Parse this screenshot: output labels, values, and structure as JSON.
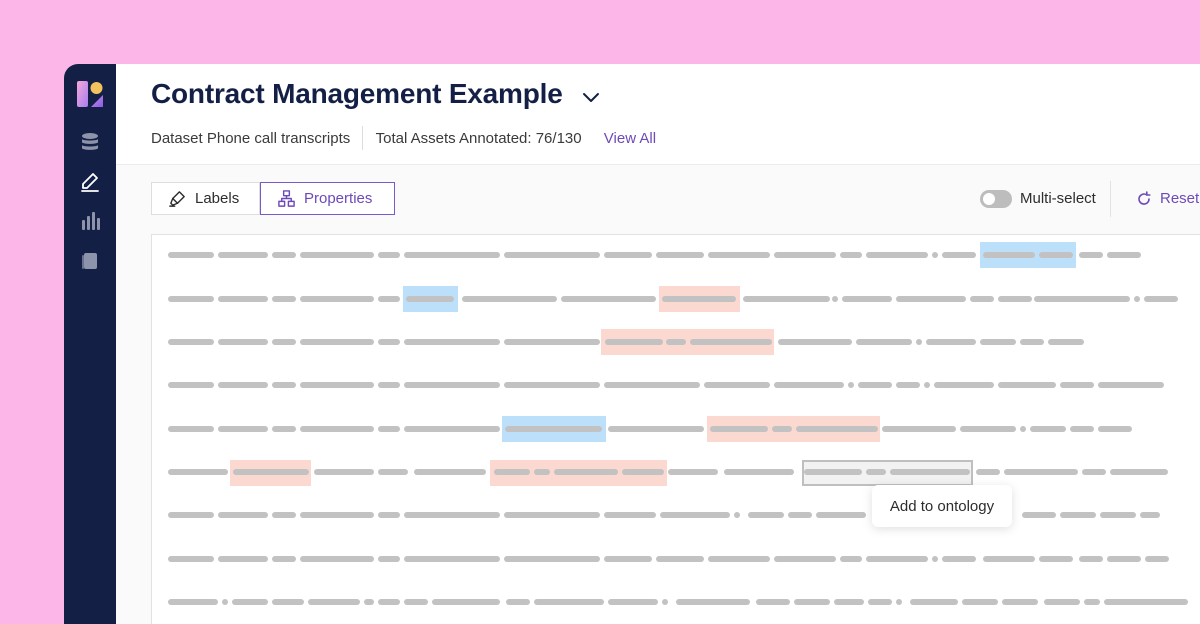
{
  "header": {
    "title": "Contract Management Example",
    "dataset": "Dataset Phone call transcripts",
    "assets_annotated": "Total Assets Annotated: 76/130",
    "view_all": "View All"
  },
  "sidebar": {
    "items": [
      {
        "icon": "database-icon"
      },
      {
        "icon": "pencil-icon",
        "active": true
      },
      {
        "icon": "bar-chart-icon"
      },
      {
        "icon": "book-icon"
      }
    ]
  },
  "toolbar": {
    "tabs": [
      {
        "label": "Labels",
        "icon": "highlighter-icon",
        "selected": false
      },
      {
        "label": "Properties",
        "icon": "hierarchy-icon",
        "selected": true
      }
    ],
    "multi_select": {
      "label": "Multi-select",
      "on": false
    },
    "reset_label": "Reset"
  },
  "tooltip": {
    "label": "Add to ontology"
  },
  "colors": {
    "brand_navy": "#141f46",
    "accent_purple": "#6e4ab8",
    "background_pink": "#fdb6e8",
    "highlight_blue": "#bde0fa",
    "highlight_salmon": "#fbd8d0"
  }
}
